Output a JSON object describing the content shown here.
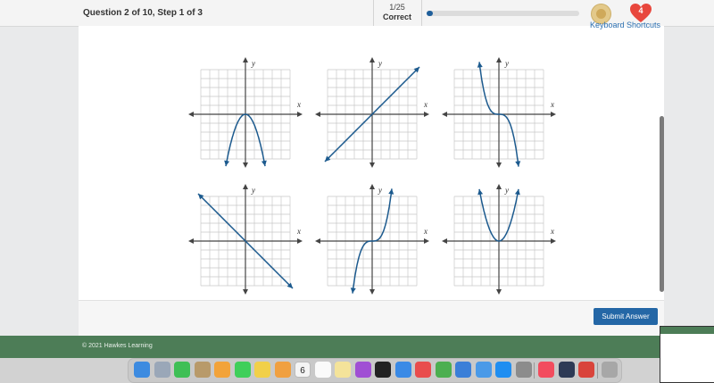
{
  "header": {
    "question_label": "Question 2 of 10, Step 1 of 3",
    "score_fraction": "1/25",
    "score_label": "Correct",
    "progress_fraction": 0.04,
    "lives_count": "4"
  },
  "content": {
    "keyboard_shortcuts_label": "Keyboard Shortcuts",
    "graphs": [
      {
        "x_label": "x",
        "y_label": "y",
        "curve": "downward parabola"
      },
      {
        "x_label": "x",
        "y_label": "y",
        "curve": "increasing line"
      },
      {
        "x_label": "x",
        "y_label": "y",
        "curve": "decreasing cubic"
      },
      {
        "x_label": "x",
        "y_label": "y",
        "curve": "decreasing line"
      },
      {
        "x_label": "x",
        "y_label": "y",
        "curve": "increasing cubic"
      },
      {
        "x_label": "x",
        "y_label": "y",
        "curve": "upward parabola"
      }
    ]
  },
  "actions": {
    "submit_label": "Submit Answer"
  },
  "footer": {
    "copyright": "© 2021 Hawkes Learning"
  },
  "dock": {
    "calendar_day": "6",
    "apps": [
      "finder-icon",
      "launchpad-icon",
      "facetime-icon",
      "contacts-icon",
      "photos-icon",
      "messages-icon",
      "notes-icon",
      "pages-icon",
      "calendar-icon",
      "reminders-icon",
      "stickies-icon",
      "podcasts-icon",
      "tv-icon",
      "safari-icon",
      "news-icon",
      "chrome-icon",
      "keynote-icon",
      "mail-icon",
      "appstore-icon",
      "settings-icon",
      "music-icon",
      "steam-icon",
      "photobooth-icon",
      "trash-icon"
    ]
  },
  "colors": {
    "accent": "#2467a6",
    "curve": "#1c5a8e",
    "footer": "#4d7d57"
  }
}
